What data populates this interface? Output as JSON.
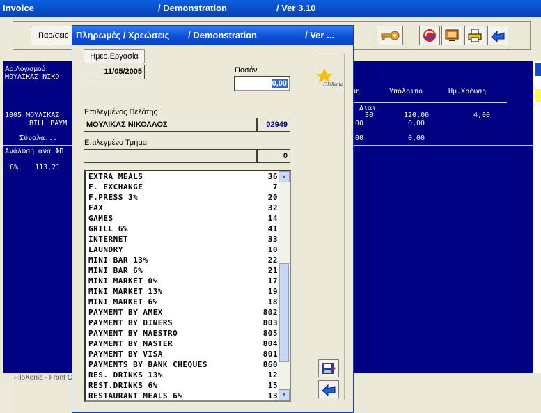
{
  "background_window": {
    "title": "Invoice",
    "title_mid": "/ Demonstration",
    "title_ver": "/  Ver  3.10",
    "toolbar_button_label": "Παρ/σεις",
    "statusbar_text": "FiloXenia - Front O",
    "account_label": "Αρ.Λογ/σμού",
    "account_name": "ΜΟΥΛΙΚΑΣ ΝΙΚΟ",
    "col_headers": [
      "ση",
      "Υπόλοιπο",
      "Ημ.Χρέωση"
    ],
    "col_sub": ": Διαι",
    "row1_left": "1005 ΜΟΥΛΙΚΑΣ",
    "row1_left2": "BILL PAYM",
    "row1_values": [
      "30",
      "120,00",
      "4,00"
    ],
    "row2_values": [
      "00",
      "0,00"
    ],
    "total_label": "Σύνολα...",
    "total_values": [
      "00",
      "0,00"
    ],
    "vat_label": "Ανάλυση ανά ΦΠ",
    "vat_row": "6%    113,21"
  },
  "dialog": {
    "title": "Πληρωμές / Χρεώσεις",
    "title_mid": "/ Demonstration",
    "title_ver": "/  Ver  ...",
    "date_button": "Ημερ.Εργασία",
    "date_value": "11/05/2005",
    "amount_label": "Ποσόν",
    "amount_value": "0,00",
    "customer_label": "Επιλεγμένος Πελάτης",
    "customer_name": "ΜΟΥΛΙΚΑΣ ΝΙΚΟΛΑΟΣ",
    "customer_code": "02949",
    "department_label": "Επιλεγμένο Τμήμα",
    "department_name": "",
    "department_code": "0",
    "logo_text": "FiloXenia",
    "items": [
      {
        "name": "EXTRA MEALS",
        "code": "36"
      },
      {
        "name": "F. EXCHANGE",
        "code": "7"
      },
      {
        "name": "F.PRESS 3%",
        "code": "20"
      },
      {
        "name": "FAX",
        "code": "32"
      },
      {
        "name": "GAMES",
        "code": "14"
      },
      {
        "name": "GRILL 6%",
        "code": "41"
      },
      {
        "name": "INTERNET",
        "code": "33"
      },
      {
        "name": "LAUNDRY",
        "code": "10"
      },
      {
        "name": "MINI BAR 13%",
        "code": "22"
      },
      {
        "name": "MINI BAR 6%",
        "code": "21"
      },
      {
        "name": "MINI MARKET 0%",
        "code": "17"
      },
      {
        "name": "MINI MARKET 13%",
        "code": "19"
      },
      {
        "name": "MINI MARKET 6%",
        "code": "18"
      },
      {
        "name": "PAYMENT BY AMEX",
        "code": "802"
      },
      {
        "name": "PAYMENT BY DINERS",
        "code": "803"
      },
      {
        "name": "PAYMENT BY MAESTRO",
        "code": "805"
      },
      {
        "name": "PAYMENT BY MASTER",
        "code": "804"
      },
      {
        "name": "PAYMENT BY VISA",
        "code": "801"
      },
      {
        "name": "PAYMENTS BY BANK CHEQUES",
        "code": "860"
      },
      {
        "name": "RES. DRINKS 13%",
        "code": "12"
      },
      {
        "name": "REST.DRINKS 6%",
        "code": "15"
      },
      {
        "name": "RESTAURANT MEALS 6%",
        "code": "13"
      }
    ]
  },
  "icons": {
    "key": "key-icon",
    "refresh": "refresh-icon",
    "screen": "monitor-icon",
    "print": "printer-icon",
    "back": "back-arrow-icon",
    "save": "save-icon",
    "exit": "exit-arrow-icon"
  },
  "colors": {
    "title_blue": "#0a4fd6",
    "panel_navy": "#000082",
    "amount_text": "#000082"
  }
}
